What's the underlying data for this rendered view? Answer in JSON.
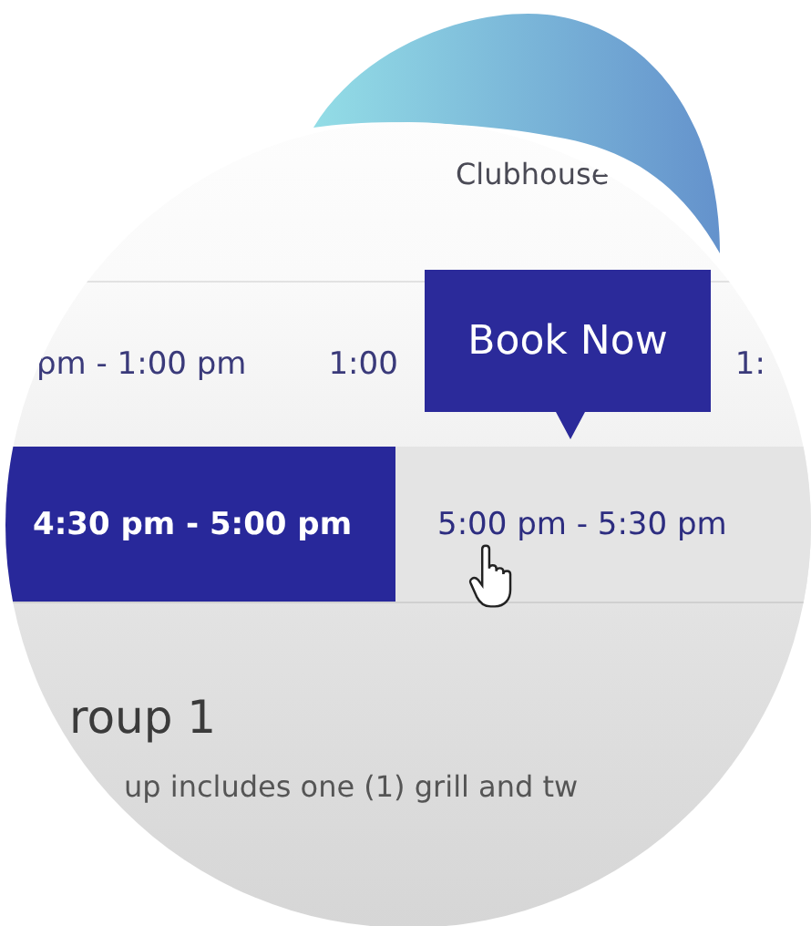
{
  "header": {
    "title": "Clubhouse"
  },
  "time_slots_row_1": [
    {
      "label": "pm - 1:00 pm",
      "selected": false
    },
    {
      "label": "1:00",
      "selected": false
    },
    {
      "label": "1:",
      "selected": false
    }
  ],
  "time_slots_row_2": [
    {
      "label": "4:30 pm - 5:00 pm",
      "selected": true
    },
    {
      "label": "5:00 pm - 5:30 pm",
      "selected": false
    }
  ],
  "tooltip": {
    "label": "Book Now"
  },
  "group": {
    "title": "roup 1",
    "description": "up includes one (1) grill and tw"
  }
}
